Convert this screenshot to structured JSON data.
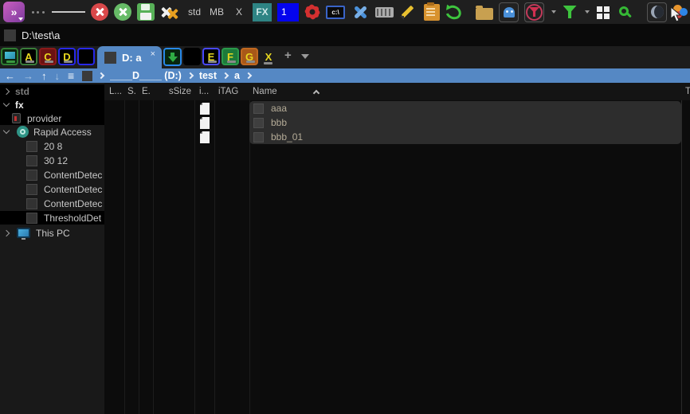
{
  "colors": {
    "accent_blue": "#5588c4",
    "toolbar_bg": "#1f1f1f",
    "panel_bg": "#0c0c0c",
    "sidebar_bg": "#191919",
    "selection_band": "#2d2d2d",
    "drive_letter_yellow": "#e8d820",
    "rapid_access_teal": "#2f9486"
  },
  "toolbar": {
    "std_label": "std",
    "mb_label": "MB",
    "x_label": "X",
    "fx_badge": "FX",
    "one_badge": "1",
    "cmd_label": "c:\\"
  },
  "addressbar": {
    "path": "D:\\test\\a"
  },
  "tabbar": {
    "left_drives": [
      {
        "letter": "A"
      },
      {
        "letter": "C"
      },
      {
        "letter": "D"
      },
      {
        "letter": ""
      }
    ],
    "active_tab": {
      "label": "D: a",
      "close": "×"
    },
    "right_drives": [
      {
        "letter": "E"
      },
      {
        "letter": "F"
      },
      {
        "letter": "G"
      },
      {
        "letter": "X"
      }
    ],
    "new_tab_label": "+"
  },
  "breadcrumb": {
    "segments": [
      "____D____ (D:)",
      "test",
      "a"
    ]
  },
  "files": {
    "columns": {
      "c1": "L...",
      "c2": "S.",
      "c3": "E.",
      "c4": "sSize",
      "c5": "i...",
      "c6": "iTAG",
      "c7": "Name",
      "c8": "T"
    },
    "sort_column": "Name",
    "sort_order": "ascending",
    "rows": [
      {
        "name": "aaa"
      },
      {
        "name": "bbb"
      },
      {
        "name": "bbb_01"
      }
    ]
  },
  "sidebar": {
    "std": "std",
    "fx": "fx",
    "provider": "provider",
    "rapid_access": "Rapid Access",
    "items": [
      "20 8",
      "30 12",
      "ContentDetec",
      "ContentDetec",
      "ContentDetec",
      "ThresholdDet"
    ],
    "this_pc": "This PC"
  }
}
